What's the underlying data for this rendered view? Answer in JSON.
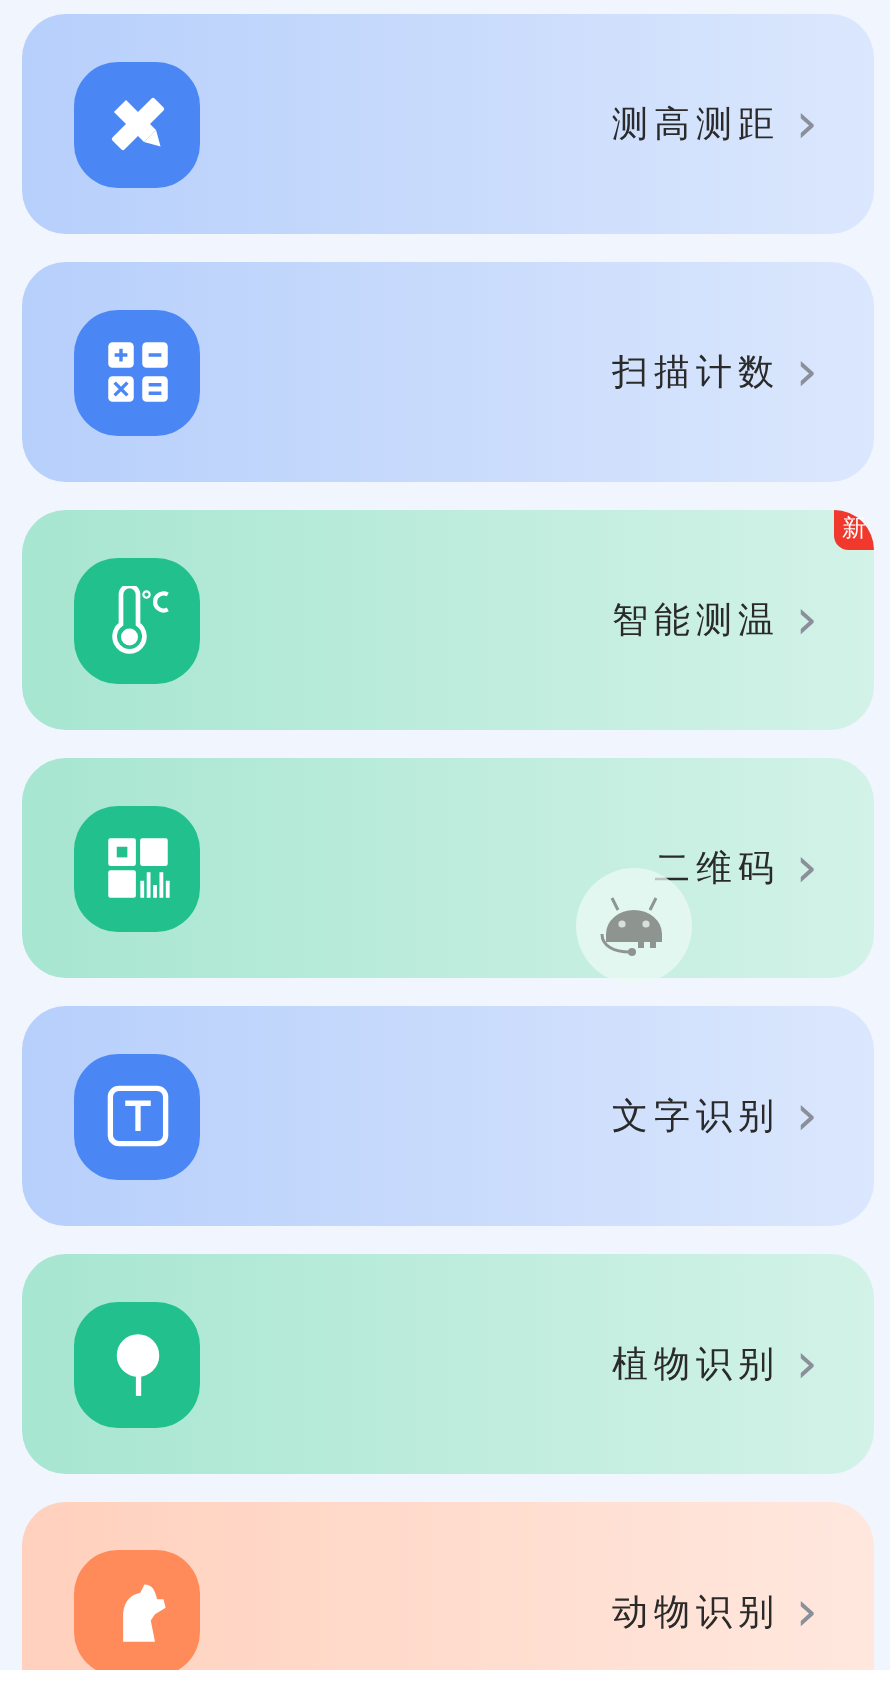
{
  "tools": [
    {
      "label": "测高测距",
      "kind": "measure",
      "color": "#4a87f5"
    },
    {
      "label": "扫描计数",
      "kind": "calculator",
      "color": "#4a87f5"
    },
    {
      "label": "智能测温",
      "kind": "thermometer",
      "color": "#22c08c",
      "badge": "新"
    },
    {
      "label": "二维码",
      "kind": "qrcode",
      "color": "#22c08c"
    },
    {
      "label": "文字识别",
      "kind": "text",
      "color": "#4a87f5"
    },
    {
      "label": "植物识别",
      "kind": "tree",
      "color": "#22c08c"
    },
    {
      "label": "动物识别",
      "kind": "dog",
      "color": "#ff8a5a"
    }
  ],
  "chevron": "›"
}
